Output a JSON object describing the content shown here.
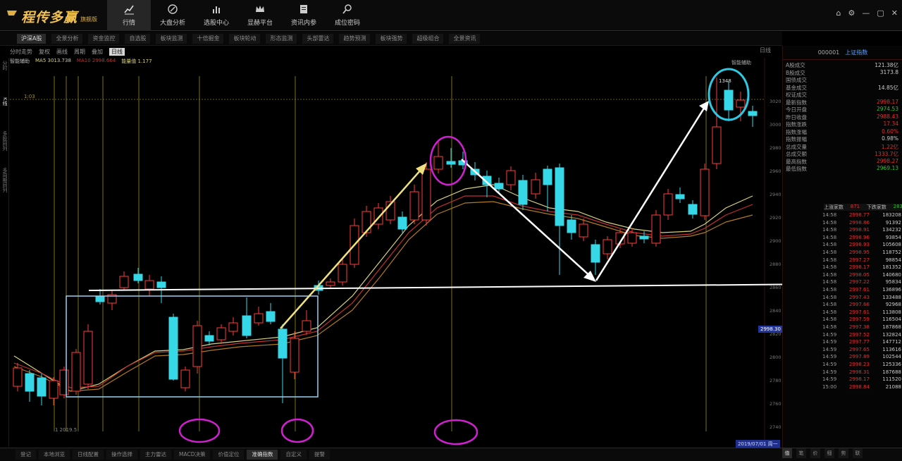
{
  "app": {
    "logo_text": "程传多赢",
    "logo_sub": "旗舰版"
  },
  "nav": [
    {
      "label": "行情",
      "icon": "chart-line-icon"
    },
    {
      "label": "大盘分析",
      "icon": "compass-icon"
    },
    {
      "label": "选股中心",
      "icon": "bar-chart-icon"
    },
    {
      "label": "显赫平台",
      "icon": "crown-icon"
    },
    {
      "label": "资讯内参",
      "icon": "document-icon"
    },
    {
      "label": "成位密码",
      "icon": "magnifier-icon"
    }
  ],
  "subtabs": [
    "沪深A股",
    "全景分析",
    "资金监控",
    "自选股",
    "板块监测",
    "十倍掘金",
    "板块轮动",
    "形态监测",
    "头部雷达",
    "趋势预测",
    "板块强势",
    "超级组合",
    "全景资讯"
  ],
  "toolbar": {
    "items": [
      "分时走势",
      "复权",
      "画线",
      "周期",
      "叠加"
    ],
    "active": "日线",
    "period_label": "日线"
  },
  "ma_line": {
    "label": "智能辅助",
    "ma1": "MA5 3013.738",
    "ma2": "MA10 2998.664",
    "ma3": "能量值 1.177"
  },
  "leftrail": [
    "分时",
    "K线",
    "多股同列",
    "多周期同列"
  ],
  "right_panel": {
    "code": "000001",
    "name": "上证指数",
    "stats": [
      {
        "k": "A股成交",
        "v": "121.38亿"
      },
      {
        "k": "B股成交",
        "v": "3173.8"
      },
      {
        "k": "国债成交",
        "v": ""
      },
      {
        "k": "基金成交",
        "v": "14.85亿"
      },
      {
        "k": "权证成交",
        "v": ""
      },
      {
        "k": "最新指数",
        "v": "2998.17"
      },
      {
        "k": "今日开盘",
        "v": "2974.53"
      },
      {
        "k": "昨日收盘",
        "v": "2988.43"
      },
      {
        "k": "指数涨跌",
        "v": "17.34"
      },
      {
        "k": "指数涨幅",
        "v": "0.60%"
      },
      {
        "k": "指数振幅",
        "v": "0.98%"
      },
      {
        "k": "总成交量",
        "v": "1.22亿"
      },
      {
        "k": "总成交额",
        "v": "1333.7亿"
      },
      {
        "k": "最高指数",
        "v": "2998.27"
      },
      {
        "k": "最低指数",
        "v": "2969.13"
      }
    ],
    "quote_head": {
      "a": "上涨家数",
      "b": "871",
      "c": "下跌家数",
      "d": "283"
    },
    "ticks": [
      {
        "t": "14:58",
        "p": "2998.77",
        "v": "183208"
      },
      {
        "t": "14:58",
        "p": "2998.86",
        "v": "91392"
      },
      {
        "t": "14:58",
        "p": "2998.91",
        "v": "134232"
      },
      {
        "t": "14:58",
        "p": "2998.96",
        "v": "93854"
      },
      {
        "t": "14:58",
        "p": "2998.93",
        "v": "105608"
      },
      {
        "t": "14:58",
        "p": "2998.95",
        "v": "118752"
      },
      {
        "t": "14:58",
        "p": "2997.27",
        "v": "98854"
      },
      {
        "t": "14:58",
        "p": "2998.17",
        "v": "181352"
      },
      {
        "t": "14:58",
        "p": "2998.05",
        "v": "140680"
      },
      {
        "t": "14:58",
        "p": "2997.22",
        "v": "95834"
      },
      {
        "t": "14:58",
        "p": "2997.61",
        "v": "136896"
      },
      {
        "t": "14:58",
        "p": "2997.43",
        "v": "133488"
      },
      {
        "t": "14:58",
        "p": "2997.66",
        "v": "92968"
      },
      {
        "t": "14:58",
        "p": "2997.61",
        "v": "113808"
      },
      {
        "t": "14:58",
        "p": "2997.59",
        "v": "116504"
      },
      {
        "t": "14:58",
        "p": "2997.38",
        "v": "187868"
      },
      {
        "t": "14:59",
        "p": "2997.52",
        "v": "132824"
      },
      {
        "t": "14:59",
        "p": "2997.77",
        "v": "147712"
      },
      {
        "t": "14:59",
        "p": "2997.65",
        "v": "113616"
      },
      {
        "t": "14:59",
        "p": "2997.89",
        "v": "102544"
      },
      {
        "t": "14:59",
        "p": "2998.23",
        "v": "125336"
      },
      {
        "t": "14:59",
        "p": "2998.31",
        "v": "187688"
      },
      {
        "t": "14:59",
        "p": "2998.17",
        "v": "111520"
      },
      {
        "t": "15:00",
        "p": "2998.84",
        "v": "21088"
      }
    ],
    "bottom_tabs": [
      "值",
      "笔",
      "价",
      "细",
      "势",
      "联"
    ]
  },
  "chart": {
    "axis_labels": [
      "3020",
      "3000",
      "2980",
      "2960",
      "2940",
      "2920",
      "2900",
      "2880",
      "2860",
      "2840",
      "2820",
      "2800",
      "2780",
      "2760",
      "2740"
    ],
    "current_badge": "2998.30",
    "date_badge": "2019/07/01 周一",
    "top_label": "1348",
    "top_right_label": "智能辅助",
    "left_price_label": "1:03",
    "bottom_axis_label": "1 2019.5"
  },
  "bottom_tabs": [
    "登记",
    "本地浏览",
    "日线配置",
    "操作选择",
    "主力雷达",
    "MACD决策",
    "价值定位",
    "准确指数",
    "自定义",
    "提警"
  ],
  "colors": {
    "up": "#ff3a3a",
    "down": "#36d8e8",
    "accent_red": "#7a1010",
    "ma_yellow": "#d8d07a",
    "ma_red": "#c03030",
    "purple_marker": "#d020d0",
    "cyan_marker": "#30c8e0"
  }
}
